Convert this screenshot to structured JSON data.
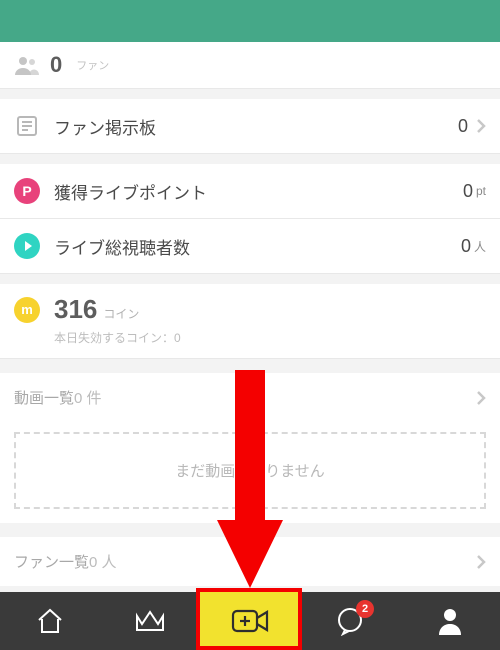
{
  "fans": {
    "count": "0",
    "label": "ファン"
  },
  "board": {
    "label": "ファン掲示板",
    "value": "0"
  },
  "points": {
    "label": "獲得ライブポイント",
    "value": "0",
    "unit": "pt"
  },
  "viewers": {
    "label": "ライブ総視聴者数",
    "value": "0",
    "unit": "人"
  },
  "coins": {
    "value": "316",
    "unit": "コイン",
    "expiring": "本日失効するコイン：0"
  },
  "videos": {
    "title": "動画一覧",
    "count": "0 件",
    "empty": "まだ動画はありません"
  },
  "fanlist": {
    "title": "ファン一覧",
    "count": "0 人"
  },
  "nav": {
    "badge": "2"
  }
}
